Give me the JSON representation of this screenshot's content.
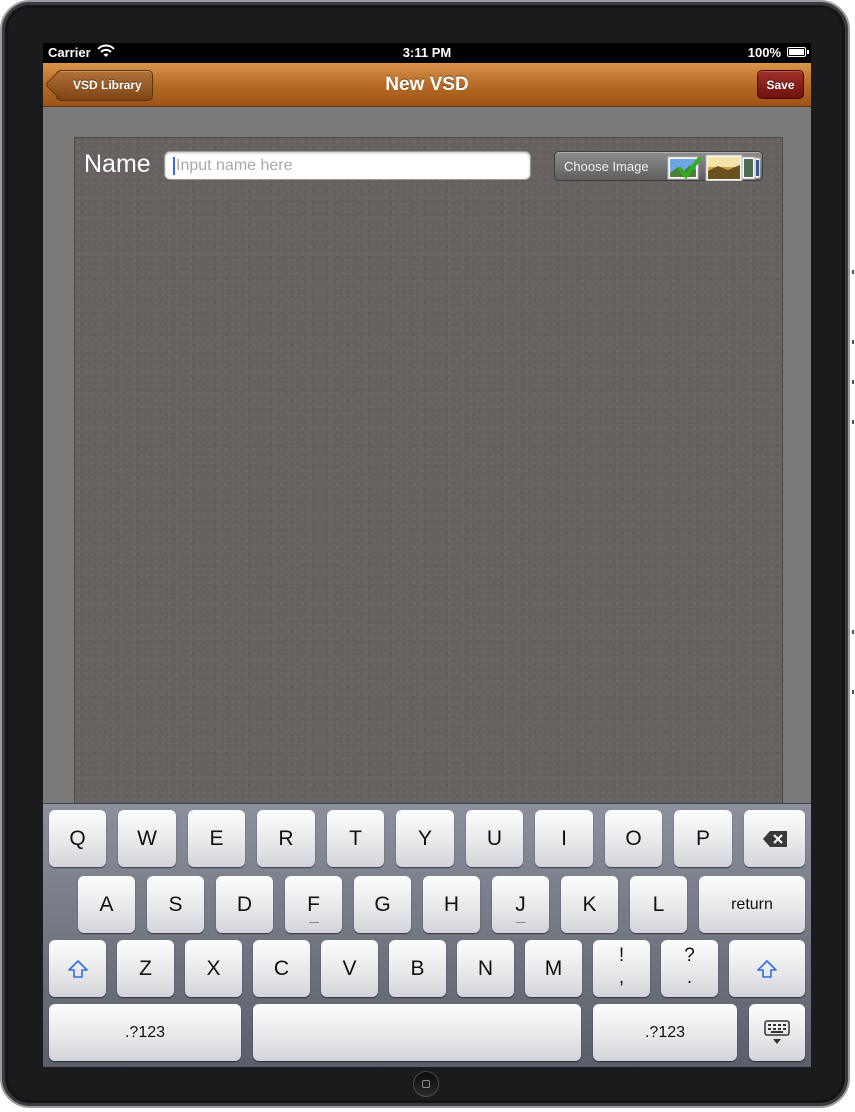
{
  "status_bar": {
    "carrier": "Carrier",
    "time": "3:11 PM",
    "battery": "100%"
  },
  "nav": {
    "back_label": "VSD Library",
    "title": "New VSD",
    "save_label": "Save"
  },
  "form": {
    "name_label": "Name",
    "name_placeholder": "Input name here",
    "choose_image_label": "Choose Image"
  },
  "keyboard": {
    "row1": [
      "Q",
      "W",
      "E",
      "R",
      "T",
      "Y",
      "U",
      "I",
      "O",
      "P"
    ],
    "row2": [
      "A",
      "S",
      "D",
      "F",
      "G",
      "H",
      "J",
      "K",
      "L"
    ],
    "return_label": "return",
    "row3": [
      "Z",
      "X",
      "C",
      "V",
      "B",
      "N",
      "M"
    ],
    "exclaim_top": "!",
    "exclaim_bottom": ",",
    "question_top": "?",
    "question_bottom": ".",
    "numbers_label": ".?123",
    "icons": {
      "backspace": "backspace-icon",
      "shift": "shift-icon",
      "dismiss": "keyboard-dismiss-icon"
    }
  },
  "colors": {
    "navbar": "#b76b26",
    "save_button": "#8a1f1a",
    "caret": "#3b66f0"
  }
}
